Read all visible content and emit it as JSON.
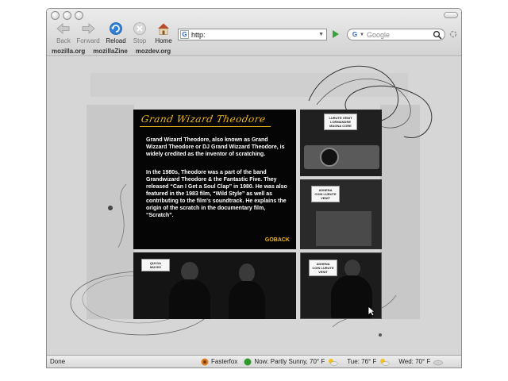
{
  "toolbar": {
    "back_label": "Back",
    "forward_label": "Forward",
    "reload_label": "Reload",
    "stop_label": "Stop",
    "home_label": "Home"
  },
  "urlbar": {
    "value": "http:"
  },
  "search": {
    "engine_icon": "G",
    "placeholder": "Google"
  },
  "bookmarks": [
    "mozilla.org",
    "mozillaZine",
    "mozdev.org"
  ],
  "page": {
    "title_art": "Grand Wizard Theodore",
    "paragraph1": "Grand Wizard Theodore, also known as Grand Wizzard Theodore or DJ Grand Wizzard Theodore, is widely credited as the inventor of scratching.",
    "paragraph2": "In the 1980s, Theodore was a part of the band Grandwizard Theodore & the Fantastic Five. They released “Can I Get a Soul Clap” in 1980. He was also featured in the 1983 film, “Wild Style” as well as contributing to the film's soundtrack. He explains the origin of the scratch in the documentary film, “Scratch”.",
    "goback_prefix": "GO",
    "goback_suffix": "BACK",
    "captions": {
      "top_right": "LURUTE VENIT LORMANDRE MAGNA CORE",
      "mid_right": "ADHENA COIN LURUTE VENIT",
      "bottom_left": "QUI DA MUVIS!",
      "bottom_right": "ADHENA COIN LURUTE VENIT"
    }
  },
  "status": {
    "text": "Done",
    "fasterfox": "Fasterfox",
    "now": "Now: Partly Sunny, 70° F",
    "tue": "Tue: 76° F",
    "wed": "Wed: 70° F"
  },
  "colors": {
    "accent_gold": "#f0b71f",
    "panel_bg": "#050505"
  }
}
